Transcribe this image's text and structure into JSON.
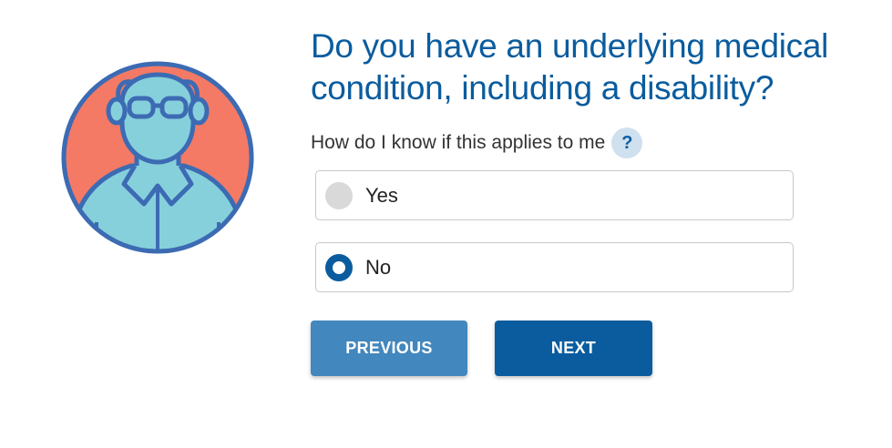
{
  "question": {
    "title": "Do you have an underlying medical condition, including a disability?"
  },
  "help": {
    "text": "How do I know if this applies to me",
    "icon_label": "?",
    "icon": "question-mark-icon"
  },
  "options": [
    {
      "label": "Yes",
      "selected": false
    },
    {
      "label": "No",
      "selected": true
    }
  ],
  "buttons": {
    "previous_label": "PREVIOUS",
    "next_label": "NEXT"
  },
  "avatar": {
    "icon": "person-with-glasses-icon"
  },
  "colors": {
    "primary": "#0a5c9e",
    "secondary_button": "#4287bd",
    "avatar_background": "#f47a66",
    "avatar_body": "#86d0dc",
    "avatar_outline": "#3c6bb3",
    "help_bubble": "#cfe0ef",
    "radio_unselected": "#d9d9d9"
  }
}
